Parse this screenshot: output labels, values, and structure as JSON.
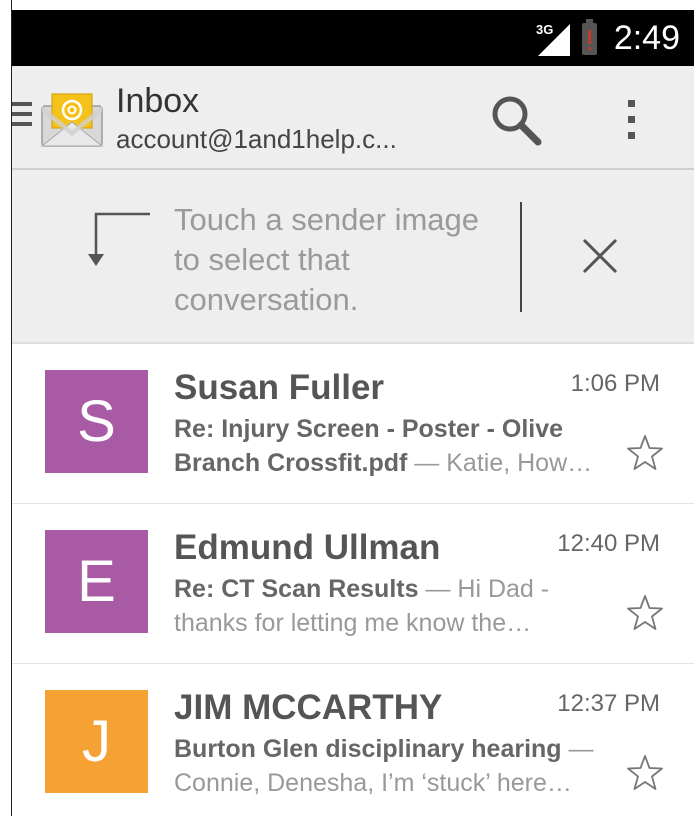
{
  "status_bar": {
    "network": "3G",
    "time": "2:49",
    "icons": [
      "signal-icon",
      "battery-icon"
    ]
  },
  "action_bar": {
    "title": "Inbox",
    "account": "account@1and1help.c...",
    "icons": [
      "menu-icon",
      "email-app-icon",
      "search-icon",
      "overflow-menu-icon"
    ]
  },
  "tip": {
    "text": "Touch a sender image to select that conversation.",
    "icons": [
      "arrow-down-icon",
      "close-icon"
    ]
  },
  "colors": {
    "purple": "#a85aa5",
    "orange": "#f6a134"
  },
  "conversations": [
    {
      "initial": "S",
      "sender": "Susan Fuller",
      "time": "1:06 PM",
      "color": "#a85aa5",
      "line1_subject": "Re: Injury Screen - Poster - Olive",
      "line2_subject": "Branch Crossfit.pdf",
      "line2_preview": " — Katie, How…",
      "line1_preview": "",
      "line2_pre": ""
    },
    {
      "initial": "E",
      "sender": "Edmund Ullman",
      "time": "12:40 PM",
      "color": "#a85aa5",
      "line1_subject": "Re: CT Scan Results",
      "line1_preview": " — Hi Dad -",
      "line2_pre": "thanks for letting me know the…",
      "line2_subject": "",
      "line2_preview": ""
    },
    {
      "initial": "J",
      "sender": "JIM MCCARTHY",
      "time": "12:37 PM",
      "color": "#f6a134",
      "line1_subject": "Burton Glen disciplinary hearing",
      "line1_preview": " —",
      "line2_pre": "Connie, Denesha, I’m ‘stuck’ here…",
      "line2_subject": "",
      "line2_preview": ""
    }
  ]
}
